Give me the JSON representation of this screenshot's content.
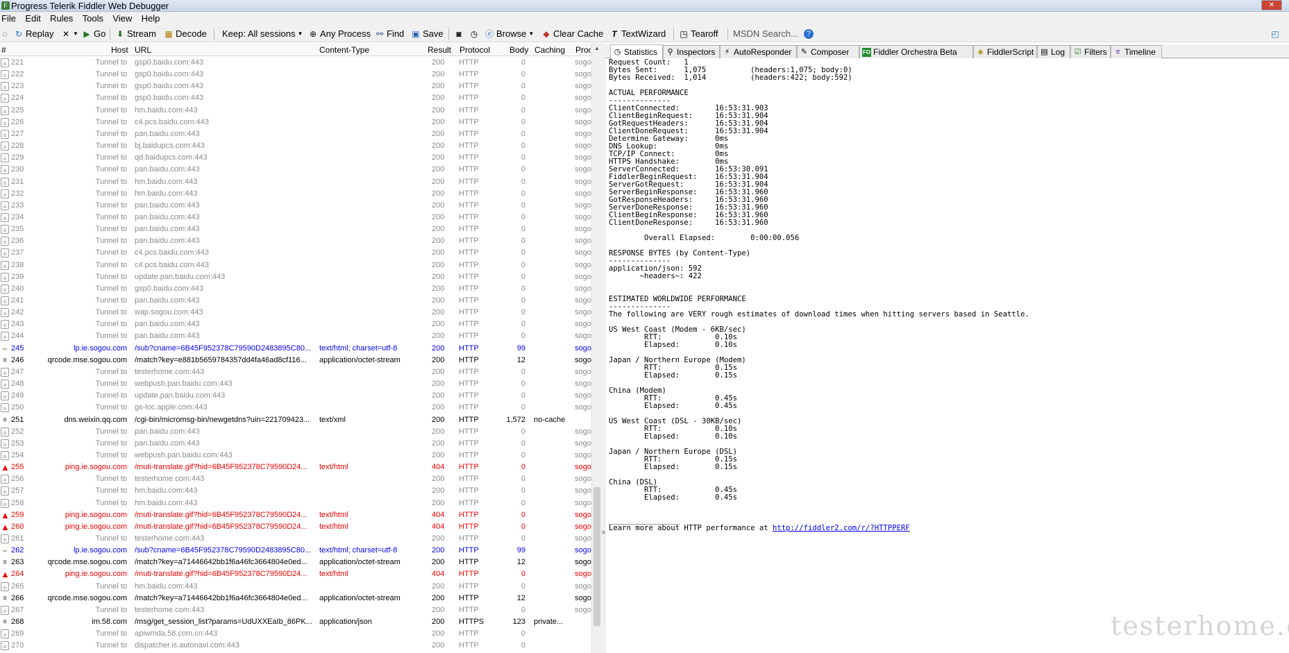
{
  "window": {
    "title": "Progress Telerik Fiddler Web Debugger"
  },
  "menu": [
    "File",
    "Edit",
    "Rules",
    "Tools",
    "View",
    "Help"
  ],
  "toolbar": {
    "replay": "Replay",
    "go": "Go",
    "stream": "Stream",
    "decode": "Decode",
    "keep": "Keep: All sessions",
    "any_process": "Any Process",
    "find": "Find",
    "save": "Save",
    "browse": "Browse",
    "clear_cache": "Clear Cache",
    "textwizard": "TextWizard",
    "tearoff": "Tearoff",
    "search_placeholder": "MSDN Search..."
  },
  "grid": {
    "headers": {
      "num": "#",
      "host": "Host",
      "url": "URL",
      "content_type": "Content-Type",
      "result": "Result",
      "protocol": "Protocol",
      "body": "Body",
      "caching": "Caching",
      "process": "Proce"
    },
    "rows": [
      {
        "num": "221",
        "host": "Tunnel to",
        "url": "gsp0.baidu.com:443",
        "ct": "",
        "res": "200",
        "proto": "HTTP",
        "body": "0",
        "cache": "",
        "proc": "sogo",
        "kind": "tunnel"
      },
      {
        "num": "222",
        "host": "Tunnel to",
        "url": "gsp0.baidu.com:443",
        "ct": "",
        "res": "200",
        "proto": "HTTP",
        "body": "0",
        "cache": "",
        "proc": "sogo",
        "kind": "tunnel"
      },
      {
        "num": "223",
        "host": "Tunnel to",
        "url": "gsp0.baidu.com:443",
        "ct": "",
        "res": "200",
        "proto": "HTTP",
        "body": "0",
        "cache": "",
        "proc": "sogo",
        "kind": "tunnel"
      },
      {
        "num": "224",
        "host": "Tunnel to",
        "url": "gsp0.baidu.com:443",
        "ct": "",
        "res": "200",
        "proto": "HTTP",
        "body": "0",
        "cache": "",
        "proc": "sogo",
        "kind": "tunnel"
      },
      {
        "num": "225",
        "host": "Tunnel to",
        "url": "hm.baidu.com:443",
        "ct": "",
        "res": "200",
        "proto": "HTTP",
        "body": "0",
        "cache": "",
        "proc": "sogo",
        "kind": "tunnel"
      },
      {
        "num": "226",
        "host": "Tunnel to",
        "url": "c4.pcs.baidu.com:443",
        "ct": "",
        "res": "200",
        "proto": "HTTP",
        "body": "0",
        "cache": "",
        "proc": "sogo",
        "kind": "tunnel"
      },
      {
        "num": "227",
        "host": "Tunnel to",
        "url": "pan.baidu.com:443",
        "ct": "",
        "res": "200",
        "proto": "HTTP",
        "body": "0",
        "cache": "",
        "proc": "sogo",
        "kind": "tunnel"
      },
      {
        "num": "228",
        "host": "Tunnel to",
        "url": "bj.baidupcs.com:443",
        "ct": "",
        "res": "200",
        "proto": "HTTP",
        "body": "0",
        "cache": "",
        "proc": "sogo",
        "kind": "tunnel"
      },
      {
        "num": "229",
        "host": "Tunnel to",
        "url": "qd.baidupcs.com:443",
        "ct": "",
        "res": "200",
        "proto": "HTTP",
        "body": "0",
        "cache": "",
        "proc": "sogo",
        "kind": "tunnel"
      },
      {
        "num": "230",
        "host": "Tunnel to",
        "url": "pan.baidu.com:443",
        "ct": "",
        "res": "200",
        "proto": "HTTP",
        "body": "0",
        "cache": "",
        "proc": "sogo",
        "kind": "tunnel"
      },
      {
        "num": "231",
        "host": "Tunnel to",
        "url": "hm.baidu.com:443",
        "ct": "",
        "res": "200",
        "proto": "HTTP",
        "body": "0",
        "cache": "",
        "proc": "sogo",
        "kind": "tunnel"
      },
      {
        "num": "232",
        "host": "Tunnel to",
        "url": "hm.baidu.com:443",
        "ct": "",
        "res": "200",
        "proto": "HTTP",
        "body": "0",
        "cache": "",
        "proc": "sogo",
        "kind": "tunnel"
      },
      {
        "num": "233",
        "host": "Tunnel to",
        "url": "pan.baidu.com:443",
        "ct": "",
        "res": "200",
        "proto": "HTTP",
        "body": "0",
        "cache": "",
        "proc": "sogo",
        "kind": "tunnel"
      },
      {
        "num": "234",
        "host": "Tunnel to",
        "url": "pan.baidu.com:443",
        "ct": "",
        "res": "200",
        "proto": "HTTP",
        "body": "0",
        "cache": "",
        "proc": "sogo",
        "kind": "tunnel"
      },
      {
        "num": "235",
        "host": "Tunnel to",
        "url": "pan.baidu.com:443",
        "ct": "",
        "res": "200",
        "proto": "HTTP",
        "body": "0",
        "cache": "",
        "proc": "sogo",
        "kind": "tunnel"
      },
      {
        "num": "236",
        "host": "Tunnel to",
        "url": "pan.baidu.com:443",
        "ct": "",
        "res": "200",
        "proto": "HTTP",
        "body": "0",
        "cache": "",
        "proc": "sogo",
        "kind": "tunnel"
      },
      {
        "num": "237",
        "host": "Tunnel to",
        "url": "c4.pcs.baidu.com:443",
        "ct": "",
        "res": "200",
        "proto": "HTTP",
        "body": "0",
        "cache": "",
        "proc": "sogo",
        "kind": "tunnel"
      },
      {
        "num": "238",
        "host": "Tunnel to",
        "url": "c4.pcs.baidu.com:443",
        "ct": "",
        "res": "200",
        "proto": "HTTP",
        "body": "0",
        "cache": "",
        "proc": "sogo",
        "kind": "tunnel"
      },
      {
        "num": "239",
        "host": "Tunnel to",
        "url": "update.pan.baidu.com:443",
        "ct": "",
        "res": "200",
        "proto": "HTTP",
        "body": "0",
        "cache": "",
        "proc": "sogo",
        "kind": "tunnel"
      },
      {
        "num": "240",
        "host": "Tunnel to",
        "url": "gsp0.baidu.com:443",
        "ct": "",
        "res": "200",
        "proto": "HTTP",
        "body": "0",
        "cache": "",
        "proc": "sogo",
        "kind": "tunnel"
      },
      {
        "num": "241",
        "host": "Tunnel to",
        "url": "pan.baidu.com:443",
        "ct": "",
        "res": "200",
        "proto": "HTTP",
        "body": "0",
        "cache": "",
        "proc": "sogo",
        "kind": "tunnel"
      },
      {
        "num": "242",
        "host": "Tunnel to",
        "url": "wap.sogou.com:443",
        "ct": "",
        "res": "200",
        "proto": "HTTP",
        "body": "0",
        "cache": "",
        "proc": "sogo",
        "kind": "tunnel"
      },
      {
        "num": "243",
        "host": "Tunnel to",
        "url": "pan.baidu.com:443",
        "ct": "",
        "res": "200",
        "proto": "HTTP",
        "body": "0",
        "cache": "",
        "proc": "sogo",
        "kind": "tunnel"
      },
      {
        "num": "244",
        "host": "Tunnel to",
        "url": "pan.baidu.com:443",
        "ct": "",
        "res": "200",
        "proto": "HTTP",
        "body": "0",
        "cache": "",
        "proc": "sogo",
        "kind": "tunnel"
      },
      {
        "num": "245",
        "host": "lp.ie.sogou.com",
        "url": "/sub?cname=6B45F952378C79590D2483895C80...",
        "ct": "text/html; charset=utf-8",
        "res": "200",
        "proto": "HTTP",
        "body": "99",
        "cache": "",
        "proc": "sogo",
        "kind": "blue"
      },
      {
        "num": "246",
        "host": "qrcode.mse.sogou.com",
        "url": "/match?key=e881b5659784357dd4fa46ad8cf116...",
        "ct": "application/octet-stream",
        "res": "200",
        "proto": "HTTP",
        "body": "12",
        "cache": "",
        "proc": "sogo",
        "kind": "normal"
      },
      {
        "num": "247",
        "host": "Tunnel to",
        "url": "testerhome.com:443",
        "ct": "",
        "res": "200",
        "proto": "HTTP",
        "body": "0",
        "cache": "",
        "proc": "sogo",
        "kind": "tunnel"
      },
      {
        "num": "248",
        "host": "Tunnel to",
        "url": "webpush.pan.baidu.com:443",
        "ct": "",
        "res": "200",
        "proto": "HTTP",
        "body": "0",
        "cache": "",
        "proc": "sogo",
        "kind": "tunnel"
      },
      {
        "num": "249",
        "host": "Tunnel to",
        "url": "update.pan.baidu.com:443",
        "ct": "",
        "res": "200",
        "proto": "HTTP",
        "body": "0",
        "cache": "",
        "proc": "sogo",
        "kind": "tunnel"
      },
      {
        "num": "250",
        "host": "Tunnel to",
        "url": "gs-loc.apple.com:443",
        "ct": "",
        "res": "200",
        "proto": "HTTP",
        "body": "0",
        "cache": "",
        "proc": "sogo",
        "kind": "tunnel"
      },
      {
        "num": "251",
        "host": "dns.weixin.qq.com",
        "url": "/cgi-bin/micromsg-bin/newgetdns?uin=221709423...",
        "ct": "text/xml",
        "res": "200",
        "proto": "HTTP",
        "body": "1,572",
        "cache": "no-cache",
        "proc": "",
        "kind": "normal"
      },
      {
        "num": "252",
        "host": "Tunnel to",
        "url": "pan.baidu.com:443",
        "ct": "",
        "res": "200",
        "proto": "HTTP",
        "body": "0",
        "cache": "",
        "proc": "sogo",
        "kind": "tunnel"
      },
      {
        "num": "253",
        "host": "Tunnel to",
        "url": "pan.baidu.com:443",
        "ct": "",
        "res": "200",
        "proto": "HTTP",
        "body": "0",
        "cache": "",
        "proc": "sogo",
        "kind": "tunnel"
      },
      {
        "num": "254",
        "host": "Tunnel to",
        "url": "webpush.pan.baidu.com:443",
        "ct": "",
        "res": "200",
        "proto": "HTTP",
        "body": "0",
        "cache": "",
        "proc": "sogo",
        "kind": "tunnel"
      },
      {
        "num": "255",
        "host": "ping.ie.sogou.com",
        "url": "/muti-translate.gif?hid=6B45F952378C79590D24...",
        "ct": "text/html",
        "res": "404",
        "proto": "HTTP",
        "body": "0",
        "cache": "",
        "proc": "sogo",
        "kind": "error"
      },
      {
        "num": "256",
        "host": "Tunnel to",
        "url": "testerhome.com:443",
        "ct": "",
        "res": "200",
        "proto": "HTTP",
        "body": "0",
        "cache": "",
        "proc": "sogo",
        "kind": "tunnel"
      },
      {
        "num": "257",
        "host": "Tunnel to",
        "url": "hm.baidu.com:443",
        "ct": "",
        "res": "200",
        "proto": "HTTP",
        "body": "0",
        "cache": "",
        "proc": "sogo",
        "kind": "tunnel"
      },
      {
        "num": "258",
        "host": "Tunnel to",
        "url": "hm.baidu.com:443",
        "ct": "",
        "res": "200",
        "proto": "HTTP",
        "body": "0",
        "cache": "",
        "proc": "sogo",
        "kind": "tunnel"
      },
      {
        "num": "259",
        "host": "ping.ie.sogou.com",
        "url": "/muti-translate.gif?hid=6B45F952378C79590D24...",
        "ct": "text/html",
        "res": "404",
        "proto": "HTTP",
        "body": "0",
        "cache": "",
        "proc": "sogo",
        "kind": "error"
      },
      {
        "num": "260",
        "host": "ping.ie.sogou.com",
        "url": "/muti-translate.gif?hid=6B45F952378C79590D24...",
        "ct": "text/html",
        "res": "404",
        "proto": "HTTP",
        "body": "0",
        "cache": "",
        "proc": "sogo",
        "kind": "error"
      },
      {
        "num": "261",
        "host": "Tunnel to",
        "url": "testerhome.com:443",
        "ct": "",
        "res": "200",
        "proto": "HTTP",
        "body": "0",
        "cache": "",
        "proc": "sogo",
        "kind": "tunnel"
      },
      {
        "num": "262",
        "host": "lp.ie.sogou.com",
        "url": "/sub?cname=6B45F952378C79590D2483895C80...",
        "ct": "text/html; charset=utf-8",
        "res": "200",
        "proto": "HTTP",
        "body": "99",
        "cache": "",
        "proc": "sogo",
        "kind": "blue"
      },
      {
        "num": "263",
        "host": "qrcode.mse.sogou.com",
        "url": "/match?key=a71446642bb1f6a46fc3664804e0ed...",
        "ct": "application/octet-stream",
        "res": "200",
        "proto": "HTTP",
        "body": "12",
        "cache": "",
        "proc": "sogo",
        "kind": "normal"
      },
      {
        "num": "264",
        "host": "ping.ie.sogou.com",
        "url": "/muti-translate.gif?hid=6B45F952378C79590D24...",
        "ct": "text/html",
        "res": "404",
        "proto": "HTTP",
        "body": "0",
        "cache": "",
        "proc": "sogo",
        "kind": "error"
      },
      {
        "num": "265",
        "host": "Tunnel to",
        "url": "hm.baidu.com:443",
        "ct": "",
        "res": "200",
        "proto": "HTTP",
        "body": "0",
        "cache": "",
        "proc": "sogo",
        "kind": "tunnel"
      },
      {
        "num": "266",
        "host": "qrcode.mse.sogou.com",
        "url": "/match?key=a71446642bb1f6a46fc3664804e0ed...",
        "ct": "application/octet-stream",
        "res": "200",
        "proto": "HTTP",
        "body": "12",
        "cache": "",
        "proc": "sogo",
        "kind": "normal"
      },
      {
        "num": "267",
        "host": "Tunnel to",
        "url": "testerhome.com:443",
        "ct": "",
        "res": "200",
        "proto": "HTTP",
        "body": "0",
        "cache": "",
        "proc": "sogo",
        "kind": "tunnel"
      },
      {
        "num": "268",
        "host": "im.58.com",
        "url": "/msg/get_session_list?params=UdUXXEaIb_86PK...",
        "ct": "application/json",
        "res": "200",
        "proto": "HTTPS",
        "body": "123",
        "cache": "private...",
        "proc": "",
        "kind": "normal"
      },
      {
        "num": "269",
        "host": "Tunnel to",
        "url": "apiwmda.58.com.cn:443",
        "ct": "",
        "res": "200",
        "proto": "HTTP",
        "body": "0",
        "cache": "",
        "proc": "",
        "kind": "tunnel"
      },
      {
        "num": "270",
        "host": "Tunnel to",
        "url": "dispatcher.is.autonavi.com:443",
        "ct": "",
        "res": "200",
        "proto": "HTTP",
        "body": "0",
        "cache": "",
        "proc": "",
        "kind": "tunnel"
      }
    ]
  },
  "tabs": [
    "Statistics",
    "Inspectors",
    "AutoResponder",
    "Composer",
    "Fiddler Orchestra Beta",
    "FiddlerScript",
    "Log",
    "Filters",
    "Timeline"
  ],
  "stats": {
    "text": "Request Count:   1\nBytes Sent:      1,075\t\t(headers:1,075; body:0)\nBytes Received:  1,014\t\t(headers:422; body:592)\n\nACTUAL PERFORMANCE\n--------------\nClientConnected:\t16:53:31.903\nClientBeginRequest:\t16:53:31.904\nGotRequestHeaders:\t16:53:31.904\nClientDoneRequest:\t16:53:31.904\nDetermine Gateway:\t0ms\nDNS Lookup: \t\t0ms\nTCP/IP Connect:\t\t0ms\nHTTPS Handshake:\t0ms\nServerConnected:\t16:53:30.091\nFiddlerBeginRequest:\t16:53:31.904\nServerGotRequest:\t16:53:31.904\nServerBeginResponse:\t16:53:31.960\nGotResponseHeaders:\t16:53:31.960\nServerDoneResponse:\t16:53:31.960\nClientBeginResponse:\t16:53:31.960\nClientDoneResponse:\t16:53:31.960\n\n\tOverall Elapsed:\t0:00:00.056\n\nRESPONSE BYTES (by Content-Type)\n--------------\napplication/json: 592\n       ~headers~: 422\n\n\nESTIMATED WORLDWIDE PERFORMANCE\n--------------\nThe following are VERY rough estimates of download times when hitting servers based in Seattle.\n\nUS West Coast (Modem - 6KB/sec)\n\tRTT:\t\t0.10s\n\tElapsed:\t0.10s\n\nJapan / Northern Europe (Modem)\n\tRTT:\t\t0.15s\n\tElapsed:\t0.15s\n\nChina (Modem)\n\tRTT:\t\t0.45s\n\tElapsed:\t0.45s\n\nUS West Coast (DSL - 30KB/sec)\n\tRTT:\t\t0.10s\n\tElapsed:\t0.10s\n\nJapan / Northern Europe (DSL)\n\tRTT:\t\t0.15s\n\tElapsed:\t0.15s\n\nChina (DSL)\n\tRTT:\t\t0.45s\n\tElapsed:\t0.45s\n\n\n________________\n",
    "learn_more": "Learn more about HTTP performance at ",
    "link": "http://fiddler2.com/r/?HTTPPERF"
  },
  "watermark": "testerhome.com"
}
